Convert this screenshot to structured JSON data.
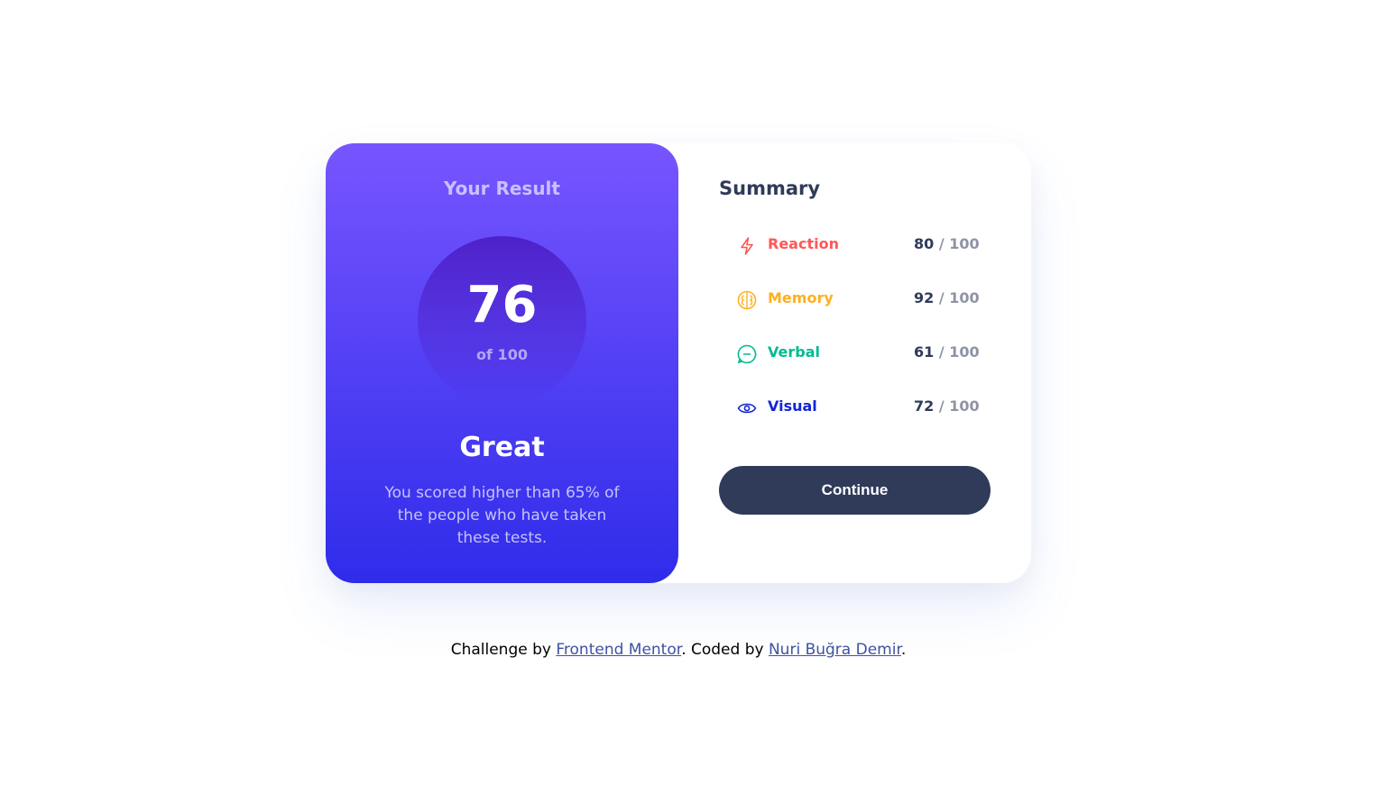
{
  "result": {
    "title": "Your Result",
    "score": "76",
    "score_of": "of 100",
    "rating": "Great",
    "description": "You scored higher than 65% of the people who have taken these tests."
  },
  "summary": {
    "title": "Summary",
    "items": [
      {
        "label": "Reaction",
        "score": "80",
        "slash": "/",
        "max": "100",
        "color": "#ff5757",
        "icon": "lightning-icon"
      },
      {
        "label": "Memory",
        "score": "92",
        "slash": "/",
        "max": "100",
        "color": "#ffb01e",
        "icon": "brain-icon"
      },
      {
        "label": "Verbal",
        "score": "61",
        "slash": "/",
        "max": "100",
        "color": "#00bb8f",
        "icon": "chat-bubble-icon"
      },
      {
        "label": "Visual",
        "score": "72",
        "slash": "/",
        "max": "100",
        "color": "#1125d6",
        "icon": "eye-icon"
      }
    ],
    "button_label": "Continue"
  },
  "attribution": {
    "prefix": "Challenge by ",
    "link1": "Frontend Mentor",
    "middle": ". Coded by ",
    "link2": "Nuri Buğra Demir",
    "suffix": "."
  },
  "colors": {
    "gradient_top": "#7755ff",
    "gradient_bottom": "#2f2cea",
    "button_bg": "#303b5a"
  }
}
